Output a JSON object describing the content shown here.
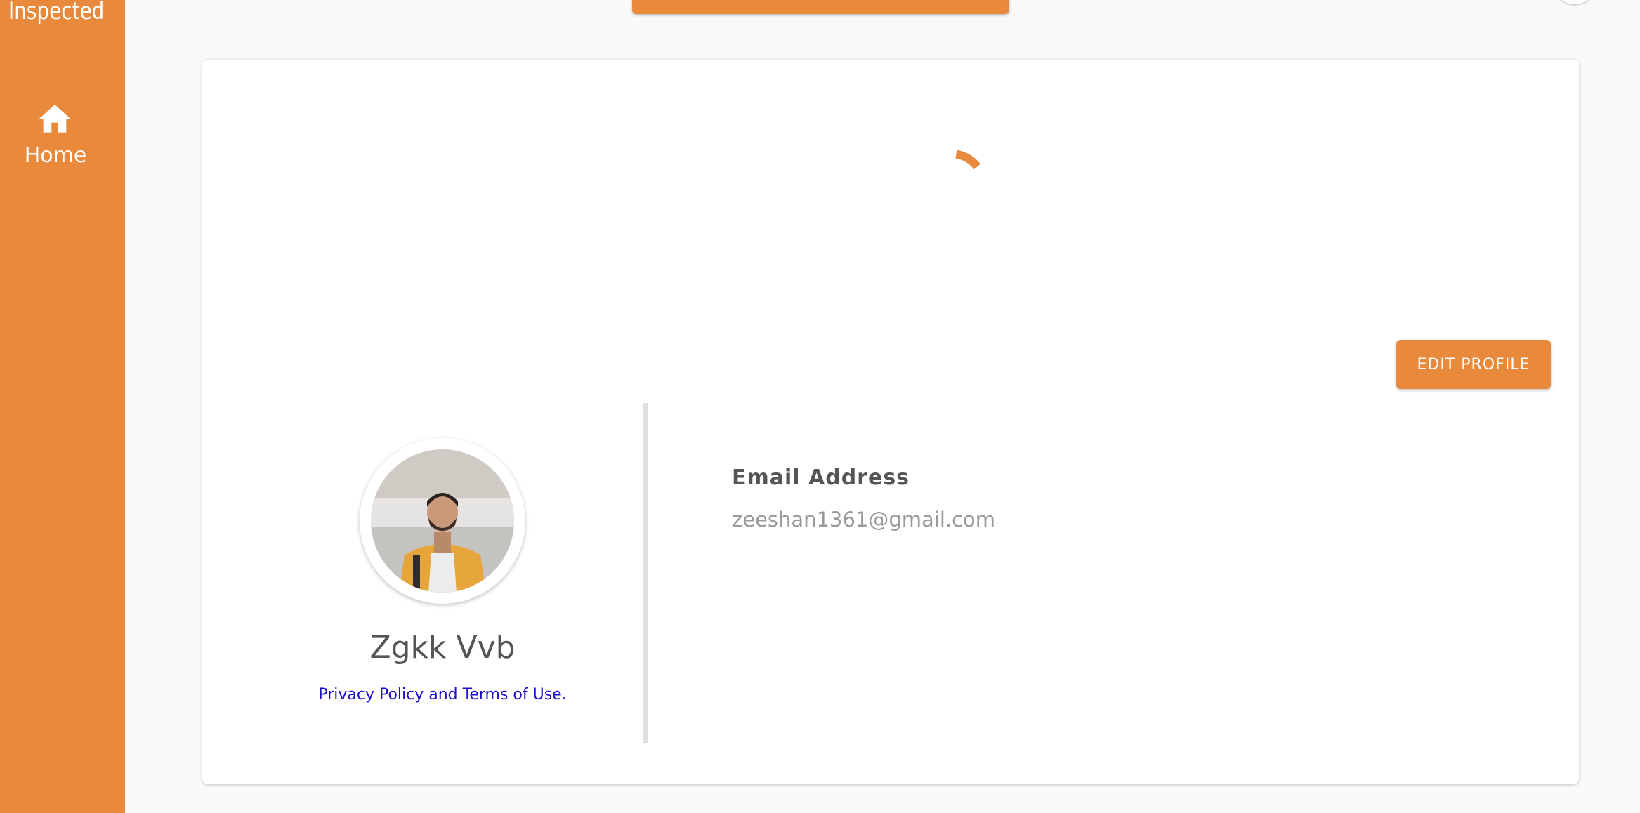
{
  "sidebar": {
    "brand_text": "Inspected",
    "nav": [
      {
        "label": "Home",
        "icon": "home-icon"
      }
    ]
  },
  "profile": {
    "edit_button_label": "EDIT PROFILE",
    "name": "Zgkk Vvb",
    "privacy_link": "Privacy Policy and Terms of Use.",
    "email_label": "Email Address",
    "email_value": "zeeshan1361@gmail.com",
    "avatar": "profile-photo"
  },
  "colors": {
    "accent": "#e8893c",
    "link": "#1a0dcc",
    "text": "#555555",
    "muted": "#9a9a9a"
  }
}
